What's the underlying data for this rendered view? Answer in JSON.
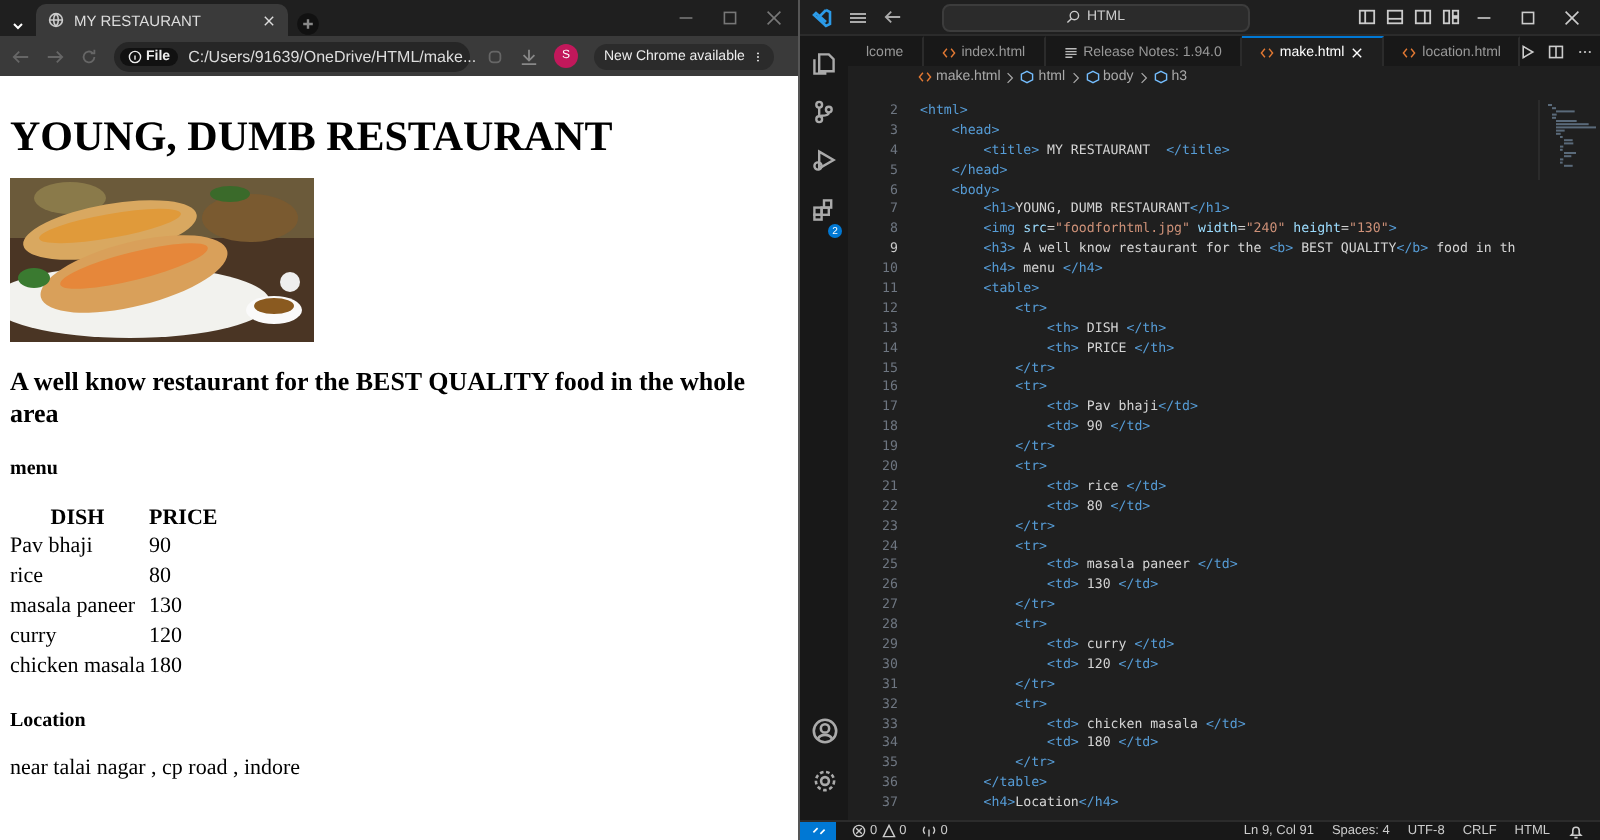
{
  "browser": {
    "tab_title": "MY RESTAURANT",
    "address_chip": "File",
    "address": "C:/Users/91639/OneDrive/HTML/make...",
    "update_button": "New Chrome available",
    "profile_initial": "S"
  },
  "page": {
    "heading": "YOUNG, DUMB RESTAURANT",
    "tagline": "A well know restaurant for the BEST QUALITY food in the whole area",
    "menu_heading": "menu",
    "table": {
      "columns": [
        "DISH",
        "PRICE"
      ],
      "rows": [
        [
          "Pav bhaji",
          "90"
        ],
        [
          "rice",
          "80"
        ],
        [
          "masala paneer",
          "130"
        ],
        [
          "curry",
          "120"
        ],
        [
          "chicken masala",
          "180"
        ]
      ]
    },
    "location_heading": "Location",
    "location_text": "near talai nagar , cp road , indore"
  },
  "editor": {
    "search": "HTML",
    "extensions_badge": "2",
    "tabs": [
      {
        "label": "lcome",
        "kind": "partial",
        "selected": false
      },
      {
        "label": "index.html",
        "kind": "file",
        "selected": false
      },
      {
        "label": "Release Notes: 1.94.0",
        "kind": "notes",
        "selected": false
      },
      {
        "label": "make.html",
        "kind": "file",
        "selected": true
      },
      {
        "label": "location.html",
        "kind": "file",
        "selected": false
      }
    ],
    "breadcrumb": [
      {
        "label": "make.html",
        "kind": "file"
      },
      {
        "label": "html",
        "kind": "element"
      },
      {
        "label": "body",
        "kind": "element"
      },
      {
        "label": "h3",
        "kind": "element"
      }
    ],
    "lines": [
      {
        "number": "2",
        "tokens": [
          {
            "kind": "tag",
            "text": "<html>"
          }
        ]
      },
      {
        "number": "3",
        "tokens": [
          {
            "kind": "tag",
            "text": "    <head>"
          }
        ]
      },
      {
        "number": "4",
        "tokens": [
          {
            "kind": "tag",
            "text": "        <title>"
          },
          {
            "kind": "text",
            "text": " MY RESTAURANT  "
          },
          {
            "kind": "tag",
            "text": "</title>"
          }
        ]
      },
      {
        "number": "5",
        "tokens": [
          {
            "kind": "tag",
            "text": "    </head>"
          }
        ]
      },
      {
        "number": "6",
        "tokens": [
          {
            "kind": "tag",
            "text": "    <body>"
          }
        ]
      },
      {
        "number": "7",
        "tokens": [
          {
            "kind": "tag",
            "text": "        <h1>"
          },
          {
            "kind": "text",
            "text": "YOUNG, DUMB RESTAURANT"
          },
          {
            "kind": "tag",
            "text": "</h1>"
          }
        ]
      },
      {
        "number": "8",
        "tokens": [
          {
            "kind": "tag",
            "text": "        <img"
          },
          {
            "kind": "attr",
            "text": " src"
          },
          {
            "kind": "text",
            "text": "="
          },
          {
            "kind": "string",
            "text": "\"foodforhtml.jpg\""
          },
          {
            "kind": "attr",
            "text": " width"
          },
          {
            "kind": "text",
            "text": "="
          },
          {
            "kind": "string",
            "text": "\"240\""
          },
          {
            "kind": "attr",
            "text": " height"
          },
          {
            "kind": "text",
            "text": "="
          },
          {
            "kind": "string",
            "text": "\"130\""
          },
          {
            "kind": "tag",
            "text": ">"
          }
        ]
      },
      {
        "number": "9",
        "tokens": [
          {
            "kind": "tag",
            "text": "        <h3>"
          },
          {
            "kind": "text",
            "text": " A well know restaurant for the "
          },
          {
            "kind": "tag",
            "text": "<b>"
          },
          {
            "kind": "text",
            "text": " BEST QUALITY"
          },
          {
            "kind": "tag",
            "text": "</b>"
          },
          {
            "kind": "text",
            "text": " food in th"
          }
        ]
      },
      {
        "number": "10",
        "tokens": [
          {
            "kind": "tag",
            "text": "        <h4>"
          },
          {
            "kind": "text",
            "text": " menu "
          },
          {
            "kind": "tag",
            "text": "</h4>"
          }
        ]
      },
      {
        "number": "11",
        "tokens": [
          {
            "kind": "tag",
            "text": "        <table>"
          }
        ]
      },
      {
        "number": "12",
        "tokens": [
          {
            "kind": "tag",
            "text": "            <tr>"
          }
        ]
      },
      {
        "number": "13",
        "tokens": [
          {
            "kind": "tag",
            "text": "                <th>"
          },
          {
            "kind": "text",
            "text": " DISH "
          },
          {
            "kind": "tag",
            "text": "</th>"
          }
        ]
      },
      {
        "number": "14",
        "tokens": [
          {
            "kind": "tag",
            "text": "                <th>"
          },
          {
            "kind": "text",
            "text": " PRICE "
          },
          {
            "kind": "tag",
            "text": "</th>"
          }
        ]
      },
      {
        "number": "15",
        "tokens": [
          {
            "kind": "tag",
            "text": "            </tr>"
          }
        ]
      },
      {
        "number": "16",
        "tokens": [
          {
            "kind": "tag",
            "text": "            <tr>"
          }
        ]
      },
      {
        "number": "17",
        "tokens": [
          {
            "kind": "tag",
            "text": "                <td>"
          },
          {
            "kind": "text",
            "text": " Pav bhaji"
          },
          {
            "kind": "tag",
            "text": "</td>"
          }
        ]
      },
      {
        "number": "18",
        "tokens": [
          {
            "kind": "tag",
            "text": "                <td>"
          },
          {
            "kind": "text",
            "text": " 90 "
          },
          {
            "kind": "tag",
            "text": "</td>"
          }
        ]
      },
      {
        "number": "19",
        "tokens": [
          {
            "kind": "tag",
            "text": "            </tr>"
          }
        ]
      },
      {
        "number": "20",
        "tokens": [
          {
            "kind": "tag",
            "text": "            <tr>"
          }
        ]
      },
      {
        "number": "21",
        "tokens": [
          {
            "kind": "tag",
            "text": "                <td>"
          },
          {
            "kind": "text",
            "text": " rice "
          },
          {
            "kind": "tag",
            "text": "</td>"
          }
        ]
      },
      {
        "number": "22",
        "tokens": [
          {
            "kind": "tag",
            "text": "                <td>"
          },
          {
            "kind": "text",
            "text": " 80 "
          },
          {
            "kind": "tag",
            "text": "</td>"
          }
        ]
      },
      {
        "number": "23",
        "tokens": [
          {
            "kind": "tag",
            "text": "            </tr>"
          }
        ]
      },
      {
        "number": "24",
        "tokens": [
          {
            "kind": "tag",
            "text": "            <tr>"
          }
        ]
      },
      {
        "number": "25",
        "tokens": [
          {
            "kind": "tag",
            "text": "                <td>"
          },
          {
            "kind": "text",
            "text": " masala paneer "
          },
          {
            "kind": "tag",
            "text": "</td>"
          }
        ]
      },
      {
        "number": "26",
        "tokens": [
          {
            "kind": "tag",
            "text": "                <td>"
          },
          {
            "kind": "text",
            "text": " 130 "
          },
          {
            "kind": "tag",
            "text": "</td>"
          }
        ]
      },
      {
        "number": "27",
        "tokens": [
          {
            "kind": "tag",
            "text": "            </tr>"
          }
        ]
      },
      {
        "number": "28",
        "tokens": [
          {
            "kind": "tag",
            "text": "            <tr>"
          }
        ]
      },
      {
        "number": "29",
        "tokens": [
          {
            "kind": "tag",
            "text": "                <td>"
          },
          {
            "kind": "text",
            "text": " curry "
          },
          {
            "kind": "tag",
            "text": "</td>"
          }
        ]
      },
      {
        "number": "30",
        "tokens": [
          {
            "kind": "tag",
            "text": "                <td>"
          },
          {
            "kind": "text",
            "text": " 120 "
          },
          {
            "kind": "tag",
            "text": "</td>"
          }
        ]
      },
      {
        "number": "31",
        "tokens": [
          {
            "kind": "tag",
            "text": "            </tr>"
          }
        ]
      },
      {
        "number": "32",
        "tokens": [
          {
            "kind": "tag",
            "text": "            <tr>"
          }
        ]
      },
      {
        "number": "33",
        "tokens": [
          {
            "kind": "tag",
            "text": "                <td>"
          },
          {
            "kind": "text",
            "text": " chicken masala "
          },
          {
            "kind": "tag",
            "text": "</td>"
          }
        ]
      },
      {
        "number": "34",
        "tokens": [
          {
            "kind": "tag",
            "text": "                <td>"
          },
          {
            "kind": "text",
            "text": " 180 "
          },
          {
            "kind": "tag",
            "text": "</td>"
          }
        ]
      },
      {
        "number": "35",
        "tokens": [
          {
            "kind": "tag",
            "text": "            </tr>"
          }
        ]
      },
      {
        "number": "36",
        "tokens": [
          {
            "kind": "tag",
            "text": "        </table>"
          }
        ]
      },
      {
        "number": "37",
        "tokens": [
          {
            "kind": "tag",
            "text": "        <h4>"
          },
          {
            "kind": "text",
            "text": "Location"
          },
          {
            "kind": "tag",
            "text": "</h4>"
          }
        ]
      }
    ],
    "status": {
      "errors": "0",
      "warnings": "0",
      "ports": "0",
      "position": "Ln 9, Col 91",
      "spaces": "Spaces: 4",
      "encoding": "UTF-8",
      "eol": "CRLF",
      "language": "HTML"
    }
  }
}
